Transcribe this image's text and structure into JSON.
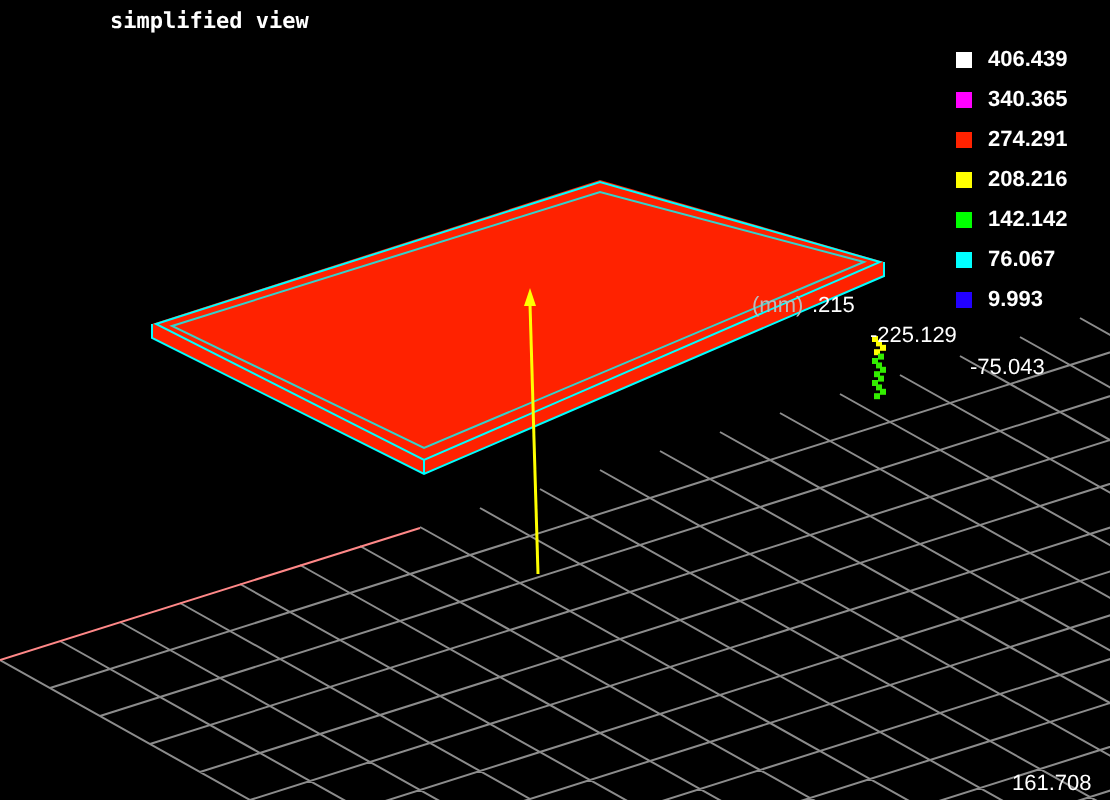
{
  "title": "simplified view",
  "legend": [
    {
      "label": "406.439",
      "color": "#ffffff"
    },
    {
      "label": "340.365",
      "color": "#ff00ff"
    },
    {
      "label": "274.291",
      "color": "#ff2200"
    },
    {
      "label": "208.216",
      "color": "#ffff00"
    },
    {
      "label": "142.142",
      "color": "#00ff00"
    },
    {
      "label": "76.067",
      "color": "#00ffff"
    },
    {
      "label": "9.993",
      "color": "#2200ff"
    }
  ],
  "axis_labels": [
    {
      "text": "(mm)",
      "kind": "unit"
    },
    {
      "text": ".215",
      "kind": "value"
    },
    {
      "text": "-225.129",
      "kind": "value"
    },
    {
      "text": "-75.043",
      "kind": "value"
    },
    {
      "text": "161.708",
      "kind": "value"
    }
  ]
}
